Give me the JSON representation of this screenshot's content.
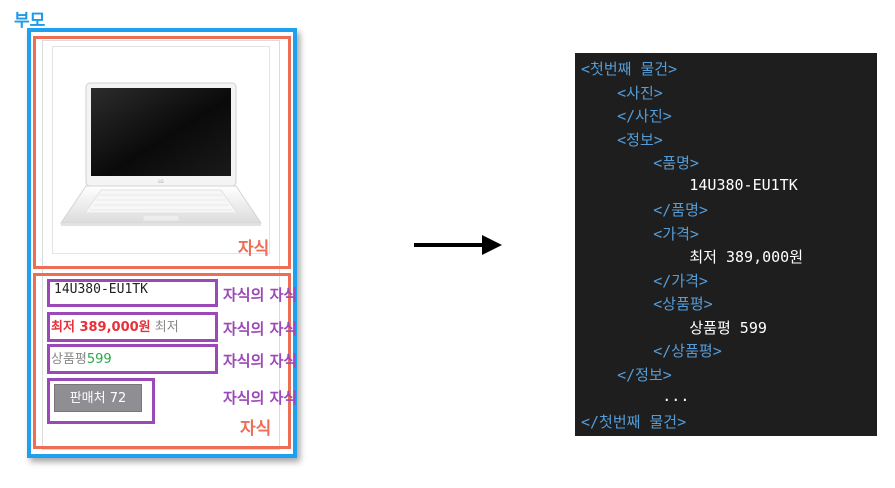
{
  "labels": {
    "parent": "부모",
    "child": "자식",
    "grandchild": "자식의 자식"
  },
  "product": {
    "model": "14U380-EU1TK",
    "price_caption": "최저 389,000원",
    "price_suffix": "최저",
    "rating_caption": "상품평",
    "rating_value": "599",
    "sellers_button": "판매처 72"
  },
  "code": {
    "lines": [
      {
        "text": "<첫번째 물건>",
        "kind": "tag"
      },
      {
        "text": "    <사진>",
        "kind": "tag"
      },
      {
        "text": "    </사진>",
        "kind": "tag"
      },
      {
        "text": "    <정보>",
        "kind": "tag"
      },
      {
        "text": "        <품명>",
        "kind": "tag"
      },
      {
        "text": "            14U380-EU1TK",
        "kind": "txt"
      },
      {
        "text": "        </품명>",
        "kind": "tag"
      },
      {
        "text": "        <가격>",
        "kind": "tag"
      },
      {
        "text": "            최저 389,000원",
        "kind": "txt"
      },
      {
        "text": "        </가격>",
        "kind": "tag"
      },
      {
        "text": "        <상품평>",
        "kind": "tag"
      },
      {
        "text": "            상품평 599",
        "kind": "txt"
      },
      {
        "text": "        </상품평>",
        "kind": "tag"
      },
      {
        "text": "    </정보>",
        "kind": "tag"
      },
      {
        "text": "         ...",
        "kind": "txt"
      },
      {
        "text": "</첫번째 물건>",
        "kind": "tag"
      }
    ]
  },
  "colors": {
    "parent": "#1ea0f0",
    "child": "#ee6e55",
    "grandchild": "#9b48b8",
    "code_bg": "#1e1e1e",
    "code_tag": "#569cd6"
  },
  "icons": {
    "laptop": "laptop-icon",
    "arrow": "arrow-right-icon"
  }
}
